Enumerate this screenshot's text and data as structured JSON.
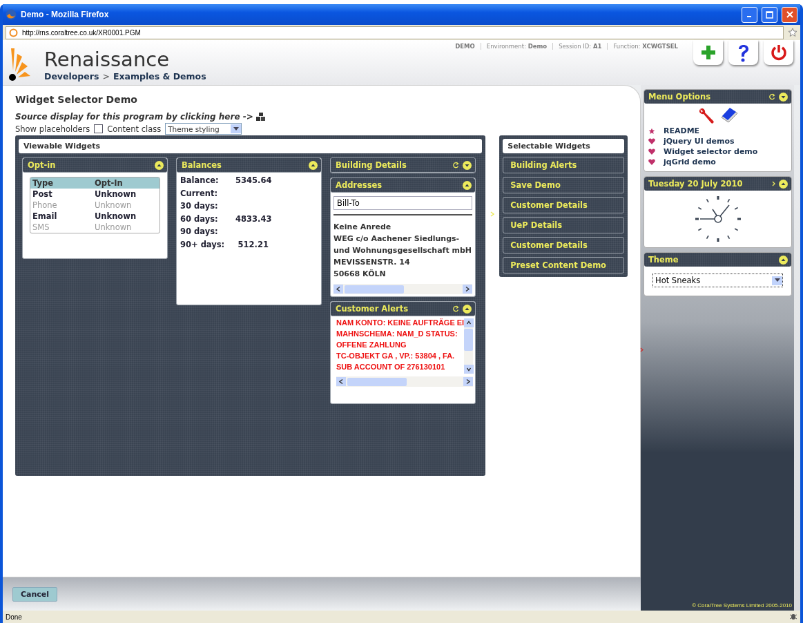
{
  "window": {
    "title": "Demo - Mozilla Firefox",
    "url": "http://rns.coraltree.co.uk/XR0001.PGM"
  },
  "header": {
    "app_name": "Renaissance",
    "breadcrumb": [
      "Developers",
      "Examples & Demos"
    ],
    "separator": ">",
    "session_info": [
      {
        "value": "DEMO"
      },
      {
        "label": "Environment:",
        "value": "Demo"
      },
      {
        "label": "Session ID:",
        "value": "A1"
      },
      {
        "label": "Function:",
        "value": "XCWGTSEL"
      }
    ]
  },
  "page": {
    "title": "Widget Selector Demo",
    "source_link": "Source display for this program by clicking here ->",
    "show_placeholders": {
      "label": "Show placeholders",
      "checked": false
    },
    "content_class": {
      "label": "Content class",
      "value": "Theme styling"
    }
  },
  "viewable": {
    "title": "Viewable Widgets",
    "columns": [
      [
        {
          "kind": "table",
          "title": "Opt-in",
          "refresh": false,
          "headers": [
            "Type",
            "Opt-In"
          ],
          "rows": [
            {
              "cells": [
                "Post",
                "Unknown"
              ],
              "enabled": true
            },
            {
              "cells": [
                "Phone",
                "Unknown"
              ],
              "enabled": false
            },
            {
              "cells": [
                "Email",
                "Unknown"
              ],
              "enabled": true
            },
            {
              "cells": [
                "SMS",
                "Unknown"
              ],
              "enabled": false
            }
          ]
        }
      ],
      [
        {
          "kind": "balances",
          "title": "Balances",
          "refresh": false,
          "rows": [
            {
              "label": "Balance:",
              "value": "5345.64"
            },
            {
              "label": "Current:"
            },
            {
              "label": "30 days:"
            },
            {
              "label": "60 days:",
              "value": "4833.43"
            },
            {
              "label": "90 days:"
            },
            {
              "label": "90+ days:",
              "value": "512.21"
            }
          ]
        }
      ],
      [
        {
          "kind": "collapsed",
          "title": "Building Details",
          "refresh": true
        },
        {
          "kind": "address",
          "title": "Addresses",
          "refresh": false,
          "field": "Bill-To",
          "lines": [
            "Keine Anrede",
            "WEG c/o Aachener Siedlungs-",
            "und Wohnungsgesellschaft mbH",
            "MEVISSENSTR. 14",
            "50668 KÖLN"
          ]
        },
        {
          "kind": "alerts",
          "title": "Customer Alerts",
          "refresh": true,
          "lines": [
            "NAM KONTO: KEINE AUFTRÄGE EI",
            "MAHNSCHEMA: NAM_D STATUS:",
            "OFFENE ZAHLUNG",
            "TC-OBJEKT GA , VP.: 53804 , FA.",
            "SUB ACCOUNT OF 276130101"
          ]
        }
      ]
    ]
  },
  "selectable": {
    "title": "Selectable Widgets",
    "items": [
      "Building Alerts",
      "Save Demo",
      "Customer Details",
      "UeP Details",
      "Customer Details",
      "Preset Content Demo"
    ]
  },
  "sidebar": {
    "menu": {
      "title": "Menu Options",
      "items": [
        {
          "kind": "star",
          "label": "README"
        },
        {
          "kind": "heart",
          "label": "jQuery UI demos"
        },
        {
          "kind": "heart",
          "label": "Widget selector demo"
        },
        {
          "kind": "heart",
          "label": "jqGrid demo"
        }
      ]
    },
    "date": {
      "title": "Tuesday 20 July 2010"
    },
    "theme": {
      "title": "Theme",
      "value": "Hot Sneaks"
    }
  },
  "footer": {
    "cancel": "Cancel",
    "copyright": "© CoralTree Systems Limited 2005-2010"
  },
  "status_bar": {
    "text": "Done"
  }
}
